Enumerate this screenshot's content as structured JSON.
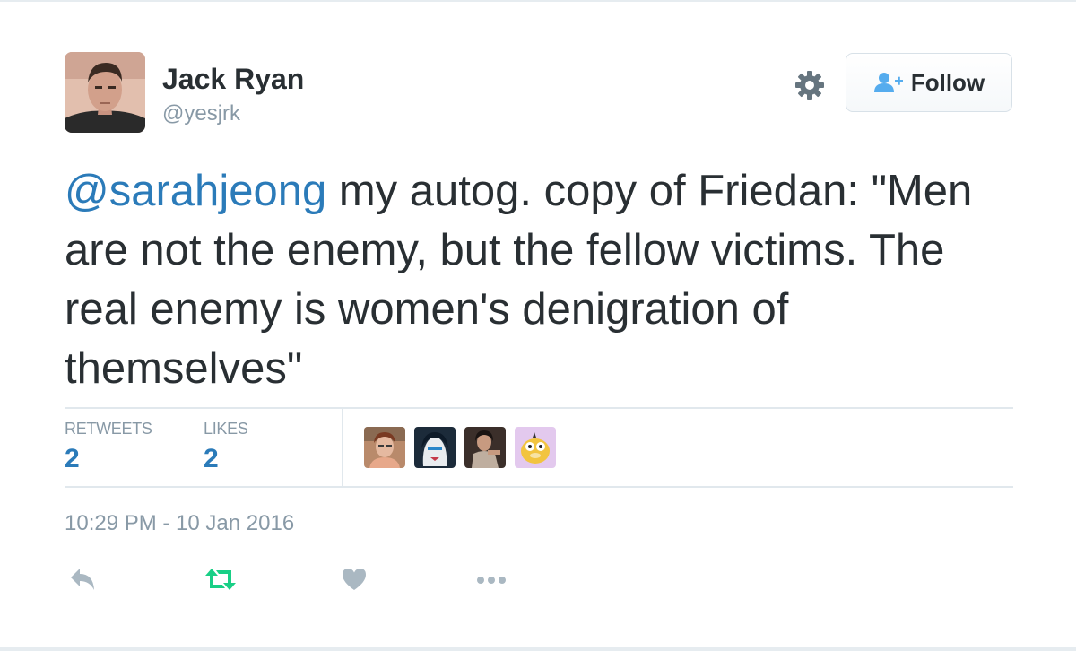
{
  "author": {
    "name": "Jack Ryan",
    "handle": "@yesjrk"
  },
  "header": {
    "follow_label": "Follow"
  },
  "tweet": {
    "mention": "@sarahjeong",
    "text": " my autog. copy of Friedan: \"Men are not the enemy, but the fellow victims. The real enemy is women's denigration of themselves\""
  },
  "stats": {
    "retweets_label": "RETWEETS",
    "retweets_count": "2",
    "likes_label": "LIKES",
    "likes_count": "2"
  },
  "timestamp": "10:29 PM - 10 Jan 2016",
  "icons": [
    "gear-icon",
    "follow-user-icon",
    "reply-icon",
    "retweet-icon",
    "heart-icon",
    "more-icon"
  ],
  "colors": {
    "link": "#2b7bb9",
    "muted": "#8899a6",
    "text": "#292f33",
    "retweet_active": "#19cf86",
    "divider": "#e1e8ed"
  }
}
